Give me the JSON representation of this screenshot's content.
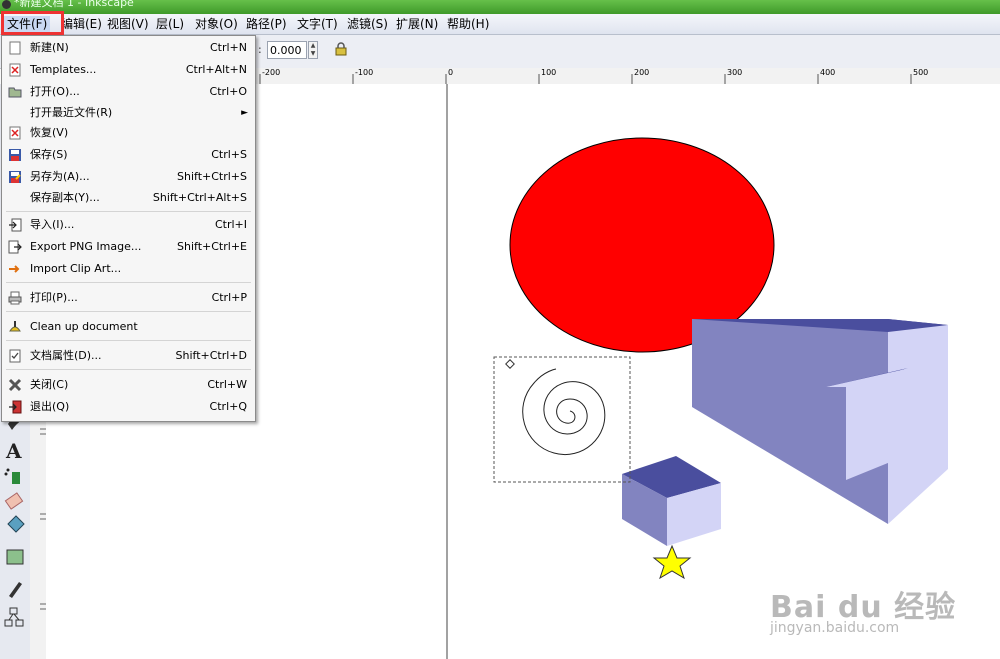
{
  "window": {
    "title": "*新建文档 1 - Inkscape"
  },
  "menubar": {
    "items": [
      "文件(F)",
      "编辑(E)",
      "视图(V)",
      "层(L)",
      "对象(O)",
      "路径(P)",
      "文字(T)",
      "滤镜(S)",
      "扩展(N)",
      "帮助(H)"
    ]
  },
  "toolbar": {
    "value": "0.000"
  },
  "ruler": {
    "labels": [
      "-200",
      "-100",
      "0",
      "100",
      "200",
      "300",
      "400",
      "500"
    ]
  },
  "file_menu": {
    "items": [
      {
        "label": "新建(N)",
        "shortcut": "Ctrl+N",
        "icon": "new-document-icon"
      },
      {
        "label": "Templates...",
        "shortcut": "Ctrl+Alt+N",
        "icon": "templates-icon"
      },
      {
        "label": "打开(O)...",
        "shortcut": "Ctrl+O",
        "icon": "open-folder-icon"
      },
      {
        "label": "打开最近文件(R)",
        "shortcut": "",
        "icon": "",
        "submenu": true
      },
      {
        "label": "恢复(V)",
        "shortcut": "",
        "icon": "revert-icon"
      },
      {
        "label": "保存(S)",
        "shortcut": "Ctrl+S",
        "icon": "save-icon"
      },
      {
        "label": "另存为(A)...",
        "shortcut": "Shift+Ctrl+S",
        "icon": "save-as-icon"
      },
      {
        "label": "保存副本(Y)...",
        "shortcut": "Shift+Ctrl+Alt+S",
        "icon": ""
      },
      {
        "label": "导入(I)...",
        "shortcut": "Ctrl+I",
        "icon": "import-icon"
      },
      {
        "label": "Export PNG Image...",
        "shortcut": "Shift+Ctrl+E",
        "icon": "export-png-icon"
      },
      {
        "label": "Import Clip Art...",
        "shortcut": "",
        "icon": "clip-art-icon"
      },
      {
        "label": "打印(P)...",
        "shortcut": "Ctrl+P",
        "icon": "print-icon"
      },
      {
        "label": "Clean up document",
        "shortcut": "",
        "icon": "clean-up-icon"
      },
      {
        "label": "文档属性(D)...",
        "shortcut": "Shift+Ctrl+D",
        "icon": "document-properties-icon"
      },
      {
        "label": "关闭(C)",
        "shortcut": "Ctrl+W",
        "icon": "close-icon"
      },
      {
        "label": "退出(Q)",
        "shortcut": "Ctrl+Q",
        "icon": "quit-icon"
      }
    ]
  },
  "colors": {
    "ellipse": "#ff0000",
    "box_top": "#4a4e9e",
    "box_front": "#8284c0",
    "box_side": "#d3d4f6",
    "star": "#ffff00",
    "highlight": "#ee3333"
  },
  "watermark": {
    "brand": "Bai du 经验",
    "url": "jingyan.baidu.com"
  }
}
